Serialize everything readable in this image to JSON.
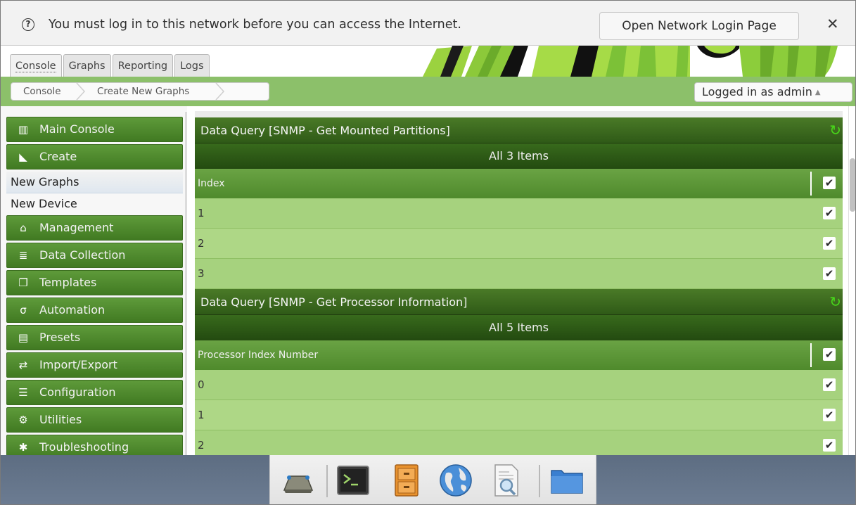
{
  "notification": {
    "icon": "question-circle-icon",
    "icon_glyph": "?",
    "message": "You must log in to this network before you can access the Internet.",
    "button_label": "Open Network Login Page",
    "close_glyph": "✕"
  },
  "tabs": [
    {
      "label": "Console",
      "active": true
    },
    {
      "label": "Graphs",
      "active": false
    },
    {
      "label": "Reporting",
      "active": false
    },
    {
      "label": "Logs",
      "active": false
    }
  ],
  "breadcrumb": [
    "Console",
    "Create New Graphs"
  ],
  "user": {
    "label": "Logged in as admin",
    "caret": "▲"
  },
  "sidebar": {
    "items": [
      {
        "label": "Main Console",
        "icon": "map-icon",
        "glyph": "▥"
      },
      {
        "label": "Create",
        "icon": "area-chart-icon",
        "glyph": "◣"
      },
      {
        "label": "New Graphs",
        "sub": true,
        "selected": true
      },
      {
        "label": "New Device",
        "sub": true,
        "selected": false
      },
      {
        "label": "Management",
        "icon": "home-icon",
        "glyph": "⌂"
      },
      {
        "label": "Data Collection",
        "icon": "database-icon",
        "glyph": "≣"
      },
      {
        "label": "Templates",
        "icon": "clone-icon",
        "glyph": "❐"
      },
      {
        "label": "Automation",
        "icon": "sigma-icon",
        "glyph": "σ"
      },
      {
        "label": "Presets",
        "icon": "archive-icon",
        "glyph": "▤"
      },
      {
        "label": "Import/Export",
        "icon": "exchange-icon",
        "glyph": "⇄"
      },
      {
        "label": "Configuration",
        "icon": "sliders-icon",
        "glyph": "☰"
      },
      {
        "label": "Utilities",
        "icon": "cogs-icon",
        "glyph": "⚙"
      },
      {
        "label": "Troubleshooting",
        "icon": "bug-icon",
        "glyph": "✱"
      }
    ]
  },
  "queries": [
    {
      "title": "Data Query [SNMP - Get Mounted Partitions]",
      "all_label": "All 3 Items",
      "column": "Index",
      "rows": [
        "1",
        "2",
        "3"
      ]
    },
    {
      "title": "Data Query [SNMP - Get Processor Information]",
      "all_label": "All 5 Items",
      "column": "Processor Index Number",
      "rows": [
        "0",
        "1",
        "2"
      ]
    }
  ],
  "check_glyph": "✔",
  "reload_glyph": "↻",
  "dock": [
    "network-drive-icon",
    "terminal-icon",
    "file-cabinet-icon",
    "globe-icon",
    "document-search-icon",
    "folder-icon"
  ]
}
